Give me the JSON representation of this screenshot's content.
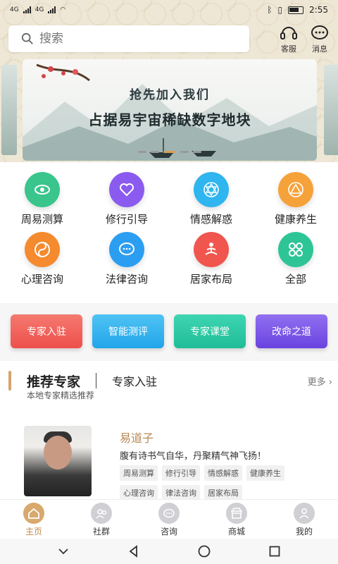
{
  "status": {
    "left_labels": [
      "4G",
      "4G"
    ],
    "time": "2:55"
  },
  "search": {
    "placeholder": "搜索"
  },
  "header_actions": [
    {
      "label": "客服",
      "icon": "headset-icon"
    },
    {
      "label": "消息",
      "icon": "chat-icon"
    }
  ],
  "banner": {
    "line1": "抢先加入我们",
    "line2": "占据易宇宙稀缺数字地块"
  },
  "categories": [
    {
      "label": "周易测算",
      "icon": "eye-icon",
      "color": "#39c58c"
    },
    {
      "label": "修行引导",
      "icon": "heart-icon",
      "color": "#8b5bf0"
    },
    {
      "label": "情感解惑",
      "icon": "hexagram-icon",
      "color": "#2fb5ef"
    },
    {
      "label": "健康养生",
      "icon": "triangle-icon",
      "color": "#f5a23b"
    },
    {
      "label": "心理咨询",
      "icon": "yinyang-icon",
      "color": "#f58a2e"
    },
    {
      "label": "法律咨询",
      "icon": "chat-bubble-icon",
      "color": "#2c9ef2"
    },
    {
      "label": "居家布局",
      "icon": "meditation-icon",
      "color": "#f0564e"
    },
    {
      "label": "全部",
      "icon": "grid-icon",
      "color": "#2ec596"
    }
  ],
  "features": [
    {
      "label": "专家入驻",
      "color": "#f0605a"
    },
    {
      "label": "智能测评",
      "color": "#2fb1ef"
    },
    {
      "label": "专家课堂",
      "color": "#2dc7a4"
    },
    {
      "label": "改命之道",
      "color": "#7b55e8"
    }
  ],
  "experts": {
    "title": "推荐专家",
    "join": "专家入驻",
    "more": "更多",
    "subtitle": "本地专家精选推荐",
    "card": {
      "name": "易道子",
      "motto": "腹有诗书气自华，丹聚精气神飞扬！",
      "tags": [
        "周易测算",
        "修行引导",
        "情感解惑",
        "健康养生",
        "心理咨询",
        "律法咨询",
        "居家布局"
      ]
    }
  },
  "tabs": [
    {
      "label": "主页",
      "active": true
    },
    {
      "label": "社群",
      "active": false
    },
    {
      "label": "咨询",
      "active": false
    },
    {
      "label": "商城",
      "active": false
    },
    {
      "label": "我的",
      "active": false
    }
  ]
}
